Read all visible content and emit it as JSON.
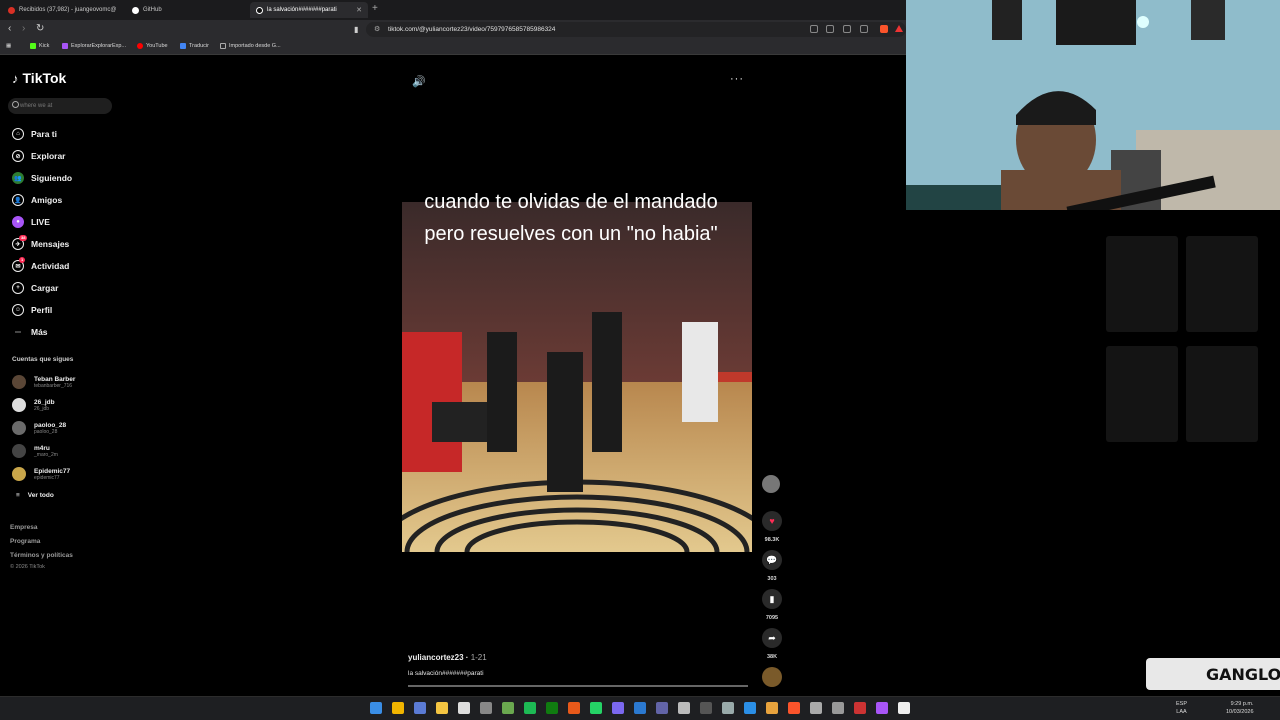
{
  "browser": {
    "tabs": [
      {
        "title": "Recibidos (37,982) - juangeovomc@",
        "active": false,
        "color": "#d93025"
      },
      {
        "title": "GitHub",
        "active": false,
        "color": "#ffffff"
      },
      {
        "title": "la salvación#######parati",
        "active": true,
        "color": "#ffffff"
      }
    ],
    "url": "tiktok.com/@yuliancortez23/video/7597976585785986324",
    "bookmarks": [
      {
        "label": "Kick",
        "color": "#53fc18"
      },
      {
        "label": "ExplorarExplorarExp...",
        "color": "#a855f7"
      },
      {
        "label": "YouTube",
        "color": "#ff0000"
      },
      {
        "label": "Traducir",
        "color": "#4285f4"
      },
      {
        "label": "Importado desde G...",
        "color": "#777777"
      }
    ]
  },
  "tiktok": {
    "logo": "TikTok",
    "search_placeholder": "where we at",
    "nav": [
      {
        "label": "Para ti",
        "icon": "home-icon",
        "glyph": "⌂"
      },
      {
        "label": "Explorar",
        "icon": "compass-icon",
        "glyph": "⊘"
      },
      {
        "label": "Siguiendo",
        "icon": "following-icon",
        "glyph": "👥"
      },
      {
        "label": "Amigos",
        "icon": "friends-icon",
        "glyph": "👤"
      },
      {
        "label": "LIVE",
        "icon": "live-icon",
        "glyph": "●"
      },
      {
        "label": "Mensajes",
        "icon": "messages-icon",
        "glyph": "✈",
        "badge": "38"
      },
      {
        "label": "Actividad",
        "icon": "activity-icon",
        "glyph": "✉",
        "badge": "1"
      },
      {
        "label": "Cargar",
        "icon": "upload-icon",
        "glyph": "+"
      },
      {
        "label": "Perfil",
        "icon": "profile-icon",
        "glyph": "☺"
      },
      {
        "label": "Más",
        "icon": "more-icon",
        "glyph": "⋯"
      }
    ],
    "following_title": "Cuentas que sigues",
    "accounts": [
      {
        "name": "Teban Barber",
        "handle": "tebanbarber_716"
      },
      {
        "name": "26_jdb",
        "handle": "26_jdb"
      },
      {
        "name": "paoloo_28",
        "handle": "paoloo_28"
      },
      {
        "name": "m4ru",
        "handle": "_maro_2m"
      },
      {
        "name": "Epidemic77",
        "handle": "epidemic77"
      }
    ],
    "see_all": "Ver todo",
    "footer": [
      "Empresa",
      "Programa",
      "Términos y políticas"
    ],
    "copyright": "© 2026 TikTok",
    "video": {
      "caption": "cuando te olvidas de el mandado pero resuelves con un \"no habia\"",
      "author": "yuliancortez23",
      "date": "1-21",
      "description": "la salvación#######parati",
      "likes": "98.3K",
      "comments": "303",
      "saves": "7095",
      "shares": "38K"
    }
  },
  "overlay": {
    "brand": "GANGLO"
  },
  "taskbar": {
    "lang_line1": "ESP",
    "lang_line2": "LAA",
    "time": "9:29 p.m.",
    "date": "10/03/2026"
  }
}
